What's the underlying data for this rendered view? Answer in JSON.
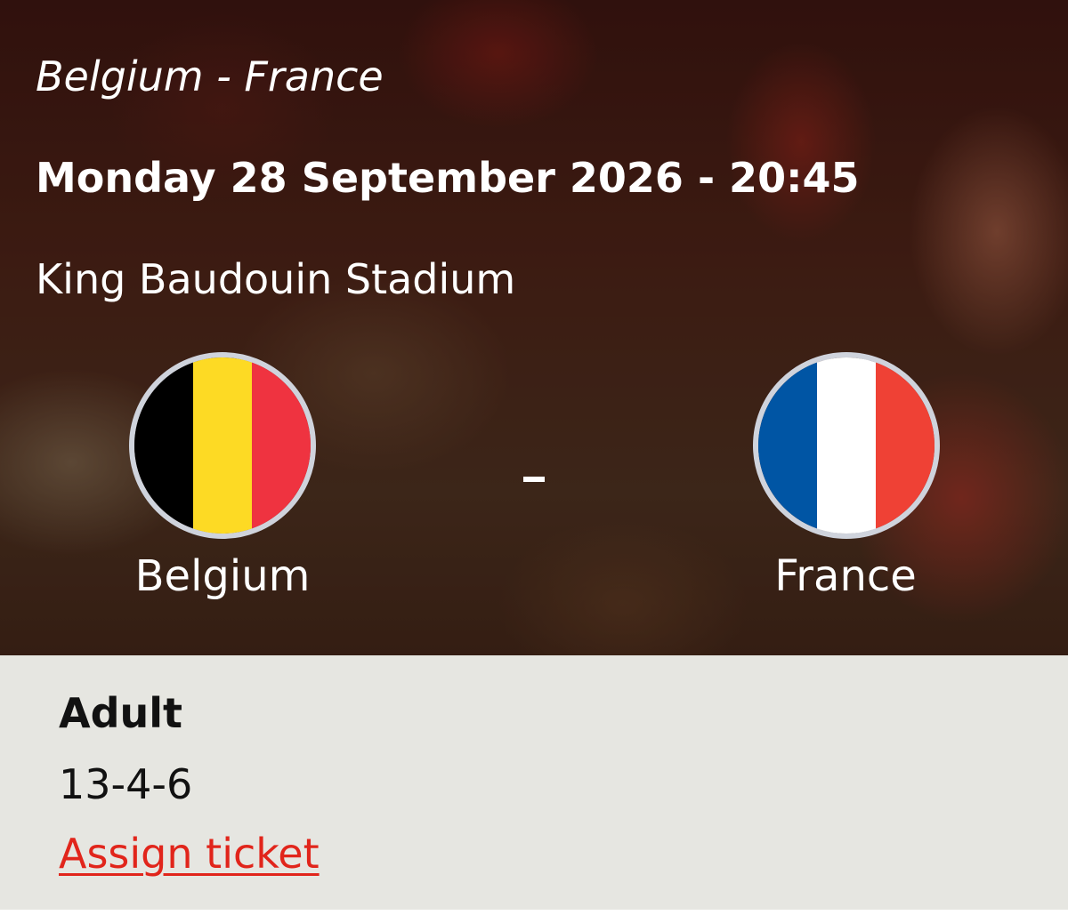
{
  "match": {
    "title": "Belgium - France",
    "datetime": "Monday 28 September 2026 - 20:45",
    "venue": "King Baudouin Stadium",
    "separator": "-"
  },
  "teams": {
    "home": {
      "name": "Belgium",
      "flag_icon": "belgium-flag-icon",
      "flag_colors": [
        "#000000",
        "#fdda24",
        "#ef3340"
      ]
    },
    "away": {
      "name": "France",
      "flag_icon": "france-flag-icon",
      "flag_colors": [
        "#0055a4",
        "#ffffff",
        "#ef4135"
      ]
    }
  },
  "ticket": {
    "type": "Adult",
    "seat": "13-4-6",
    "assign_label": "Assign ticket"
  },
  "colors": {
    "accent_link": "#e1251b",
    "panel_background": "#e6e6e1",
    "flag_border": "#cfd3dc"
  }
}
